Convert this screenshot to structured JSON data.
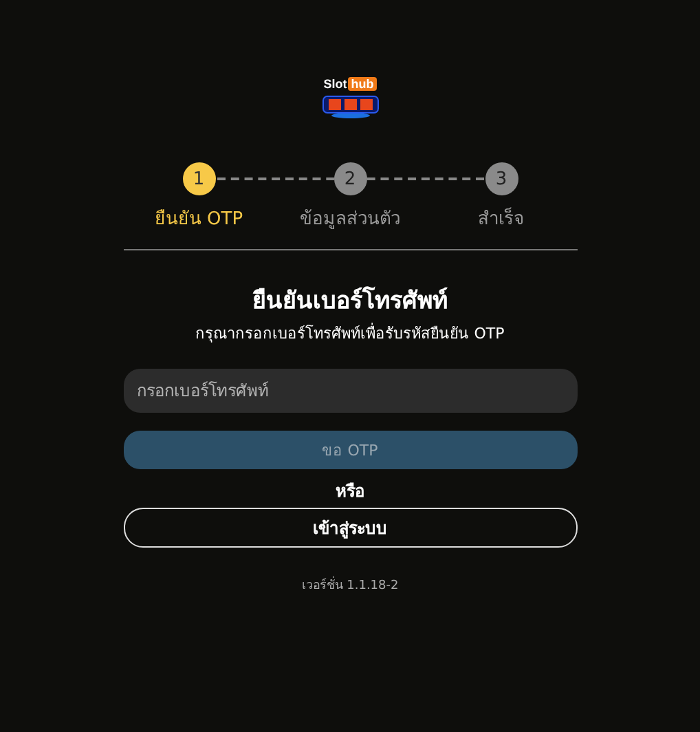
{
  "logo": {
    "word_1": "Slot",
    "word_2": "hub"
  },
  "steps": [
    {
      "number": "1",
      "label": "ยืนยัน OTP",
      "selected": true
    },
    {
      "number": "2",
      "label": "ข้อมูลส่วนตัว",
      "selected": false
    },
    {
      "number": "3",
      "label": "สำเร็จ",
      "selected": false
    }
  ],
  "title": "ยืนยันเบอร์โทรศัพท์",
  "subtitle": "กรุณากรอกเบอร์โทรศัพท์เพื่อรับรหัสยืนยัน OTP",
  "phone_field": {
    "placeholder": "กรอกเบอร์โทรศัพท์"
  },
  "otp_button": {
    "label": "ขอ OTP",
    "disabled": true
  },
  "separator": "หรือ",
  "login_button": {
    "label": "เข้าสู่ระบบ"
  },
  "version": "เวอร์ชั่น 1.1.18-2"
}
